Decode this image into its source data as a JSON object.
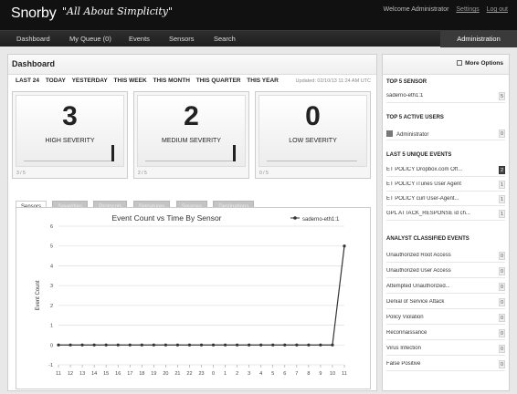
{
  "app": {
    "logo": "Snorby",
    "tagline": "\"All About Simplicity\""
  },
  "user": {
    "welcome": "Welcome Administrator",
    "settings": "Settings",
    "logout": "Log out"
  },
  "nav": {
    "items": [
      "Dashboard",
      "My Queue (0)",
      "Events",
      "Sensors",
      "Search"
    ],
    "admin": "Administration"
  },
  "dashboard": {
    "title": "Dashboard",
    "ranges": [
      "LAST 24",
      "TODAY",
      "YESTERDAY",
      "THIS WEEK",
      "THIS MONTH",
      "THIS QUARTER",
      "THIS YEAR"
    ],
    "updated": "Updated: 02/10/13 11:24 AM UTC",
    "severity": [
      {
        "count": "3",
        "label": "HIGH SEVERITY",
        "ratio": "3 / 5"
      },
      {
        "count": "2",
        "label": "MEDIUM SEVERITY",
        "ratio": "2 / 5"
      },
      {
        "count": "0",
        "label": "LOW SEVERITY",
        "ratio": "0 / 5"
      }
    ],
    "tabs": [
      "Sensors",
      "Severities",
      "Protocols",
      "Signatures",
      "Sources",
      "Destinations"
    ]
  },
  "sidebar": {
    "more_options": "More Options",
    "top_sensor_title": "TOP 5 SENSOR",
    "top_sensor": [
      {
        "label": "saderno-eth1:1",
        "count": "5"
      }
    ],
    "active_users_title": "TOP 5 ACTIVE USERS",
    "active_users": [
      {
        "label": "Administrator",
        "count": "0"
      }
    ],
    "unique_events_title": "LAST 5 UNIQUE EVENTS",
    "unique_events": [
      {
        "label": "ET POLICY Dropbox.com Off...",
        "count": "2"
      },
      {
        "label": "ET POLICY iTunes User Agent",
        "count": "1"
      },
      {
        "label": "ET POLICY curl User-Agent...",
        "count": "1"
      },
      {
        "label": "GPL ATTACK_RESPONSE id ch...",
        "count": "1"
      }
    ],
    "classified_title": "ANALYST CLASSIFIED EVENTS",
    "classified": [
      {
        "label": "Unauthorized Root Access",
        "count": "0"
      },
      {
        "label": "Unauthorized User Access",
        "count": "0"
      },
      {
        "label": "Attempted Unauthorized...",
        "count": "0"
      },
      {
        "label": "Denial of Service Attack",
        "count": "0"
      },
      {
        "label": "Policy Violation",
        "count": "0"
      },
      {
        "label": "Reconnaissance",
        "count": "0"
      },
      {
        "label": "Virus Infection",
        "count": "0"
      },
      {
        "label": "False Positive",
        "count": "0"
      }
    ]
  },
  "chart_data": {
    "type": "line",
    "title": "Event Count vs Time By Sensor",
    "ylabel": "Event Count",
    "xlabel": "",
    "ylim": [
      -1,
      6
    ],
    "yticks": [
      -1,
      0,
      1,
      2,
      3,
      4,
      5,
      6
    ],
    "categories": [
      "11",
      "12",
      "13",
      "14",
      "15",
      "16",
      "17",
      "18",
      "19",
      "20",
      "21",
      "22",
      "23",
      "0",
      "1",
      "2",
      "3",
      "4",
      "5",
      "6",
      "7",
      "8",
      "9",
      "10",
      "11"
    ],
    "series": [
      {
        "name": "saderno-eth1:1",
        "values": [
          0,
          0,
          0,
          0,
          0,
          0,
          0,
          0,
          0,
          0,
          0,
          0,
          0,
          0,
          0,
          0,
          0,
          0,
          0,
          0,
          0,
          0,
          0,
          0,
          5
        ]
      }
    ],
    "legend": "top-right",
    "grid": true
  }
}
